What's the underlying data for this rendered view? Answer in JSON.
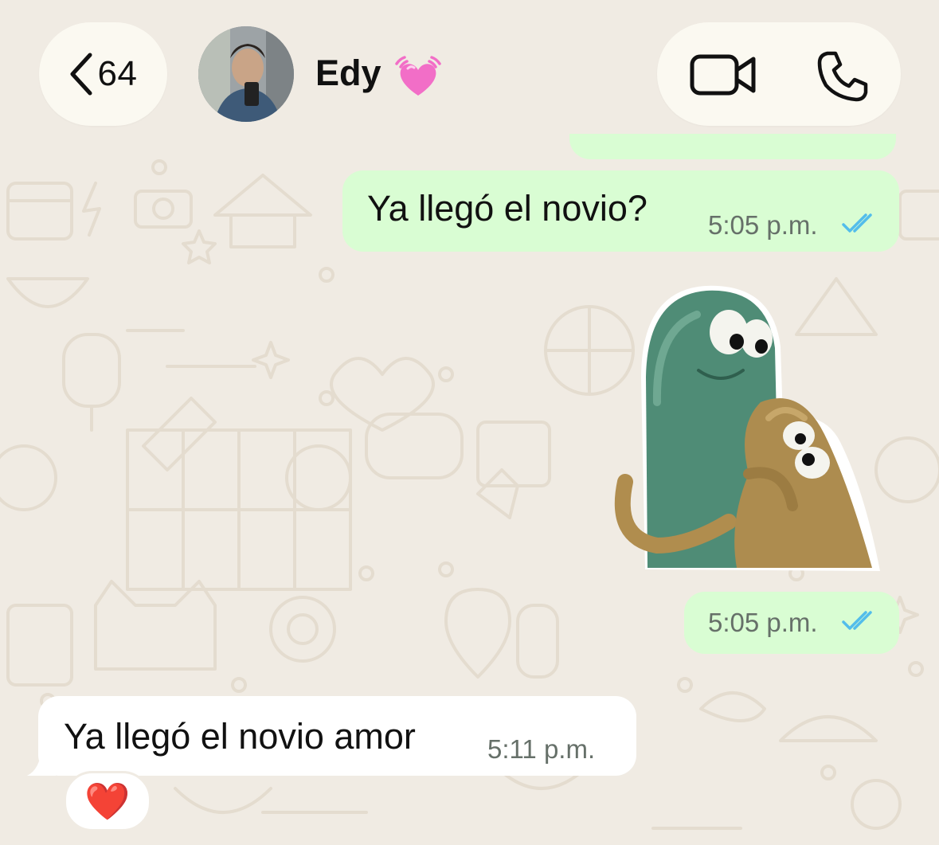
{
  "header": {
    "back_count": "64",
    "contact_name": "Edy",
    "name_emoji": "beating-heart-emoji",
    "video_icon": "video-camera-icon",
    "phone_icon": "phone-icon"
  },
  "messages": [
    {
      "direction": "outgoing",
      "text": "Ya llegó el novio?",
      "time": "5:05 p.m.",
      "status": "read"
    },
    {
      "direction": "outgoing",
      "type": "sticker",
      "sticker": "green-and-tan-clay-creatures-hugging",
      "time": "5:05 p.m.",
      "status": "read"
    },
    {
      "direction": "incoming",
      "text": "Ya llegó el novio amor",
      "time": "5:11 p.m.",
      "reaction": "❤️"
    }
  ],
  "colors": {
    "background": "#f0ebe3",
    "outgoing_bubble": "#d9fdd3",
    "incoming_bubble": "#ffffff",
    "read_ticks": "#53bdeb",
    "time_text": "#667069"
  }
}
